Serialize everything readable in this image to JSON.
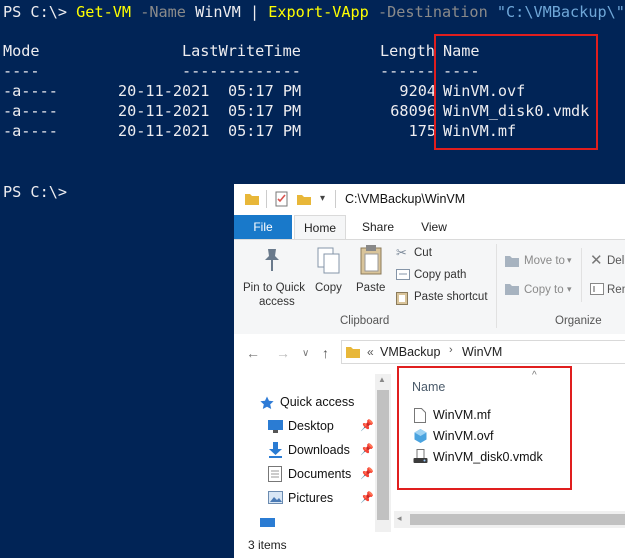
{
  "terminal": {
    "prompt1": "PS C:\\> ",
    "cmd1": "Get-VM",
    "param1": "-Name",
    "arg1": "WinVM",
    "pipe": "|",
    "cmd2": "Export-VApp",
    "param2": "-Destination",
    "arg2": "\"C:\\VMBackup\\\"",
    "headers": [
      "Mode",
      "LastWriteTime",
      "Length",
      "Name"
    ],
    "underlines": [
      "----",
      "-------------",
      "------",
      "----"
    ],
    "rows": [
      {
        "mode": "-a----",
        "date": "20-11-2021",
        "time": "05:17 PM",
        "length": "9204",
        "name": "WinVM.ovf"
      },
      {
        "mode": "-a----",
        "date": "20-11-2021",
        "time": "05:17 PM",
        "length": "68096",
        "name": "WinVM_disk0.vmdk"
      },
      {
        "mode": "-a----",
        "date": "20-11-2021",
        "time": "05:17 PM",
        "length": "175",
        "name": "WinVM.mf"
      }
    ],
    "prompt2": "PS C:\\>",
    "colors": {
      "background": "#012456",
      "text": "#eeedf0",
      "command": "#ffff00",
      "param": "#8a8a8a",
      "string": "#6fa7d8",
      "highlight": "#e01e1e"
    }
  },
  "explorer": {
    "title": "C:\\VMBackup\\WinVM",
    "tabs": [
      "File",
      "Home",
      "Share",
      "View"
    ],
    "ribbon": {
      "pin_label_1": "Pin to Quick",
      "pin_label_2": "access",
      "copy": "Copy",
      "paste": "Paste",
      "cut": "Cut",
      "copy_path": "Copy path",
      "paste_shortcut": "Paste shortcut",
      "move_to": "Move to",
      "copy_to": "Copy to",
      "delete_partial": "Del",
      "rename_partial": "Ren",
      "group_clipboard": "Clipboard",
      "group_organize": "Organize"
    },
    "breadcrumb": [
      "VMBackup",
      "WinVM"
    ],
    "breadcrumb_overflow": "«",
    "nav": [
      {
        "label": "Quick access",
        "icon": "star-icon",
        "pinned": false
      },
      {
        "label": "Desktop",
        "icon": "desktop-icon",
        "pinned": true
      },
      {
        "label": "Downloads",
        "icon": "download-icon",
        "pinned": true
      },
      {
        "label": "Documents",
        "icon": "documents-icon",
        "pinned": true
      },
      {
        "label": "Pictures",
        "icon": "pictures-icon",
        "pinned": true
      }
    ],
    "column_name": "Name",
    "files": [
      {
        "name": "WinVM.mf",
        "icon": "file-icon"
      },
      {
        "name": "WinVM.ovf",
        "icon": "ovf-file-icon"
      },
      {
        "name": "WinVM_disk0.vmdk",
        "icon": "disk-file-icon"
      }
    ],
    "status_text": "3 items",
    "colors": {
      "file_tab": "#1979ca",
      "folder": "#e8b739",
      "highlight": "#e01e1e"
    }
  }
}
